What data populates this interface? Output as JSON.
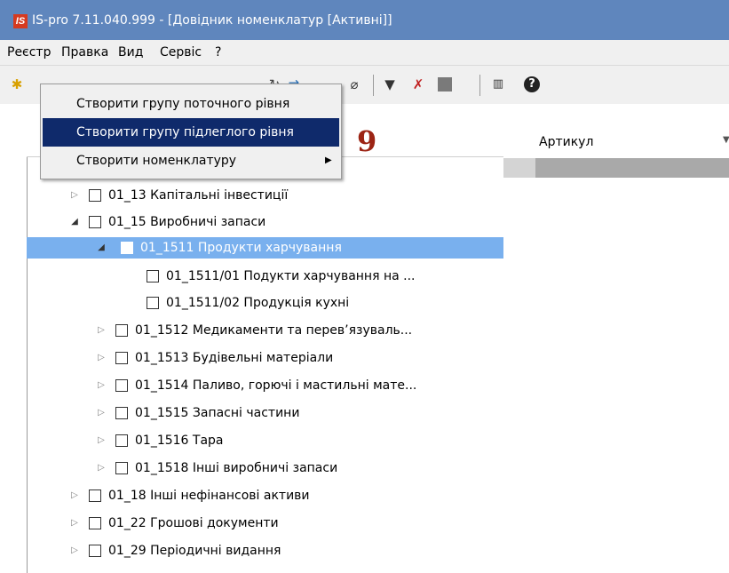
{
  "window": {
    "title": "IS-pro 7.11.040.999 - [Довідник номенклатур [Активні]]",
    "logo_text": "IS"
  },
  "menu": [
    "Реєстр",
    "Правка",
    "Вид",
    "Сервіс",
    "?"
  ],
  "toolbar": {
    "icons": [
      "new-icon",
      "edit-icon",
      "delete-icon",
      "save-icon",
      "print-icon",
      "undo-icon",
      "refresh-icon",
      "transfer-icon",
      "attach-icon",
      "filter-icon",
      "clear-filter-icon",
      "gray-square-icon",
      "columns-icon",
      "help-icon"
    ]
  },
  "context_menu": {
    "items": [
      {
        "label": "Створити групу поточного рівня",
        "highlighted": false
      },
      {
        "label": "Створити групу підлеглого рівня",
        "highlighted": true
      },
      {
        "label": "Створити номенклатуру",
        "submenu": true
      }
    ]
  },
  "annotation": "9",
  "grid": {
    "columns": [
      "Артикул"
    ]
  },
  "tree": [
    {
      "label": "01_13 Капітальні інвестиції",
      "expanded": false
    },
    {
      "label": "01_15 Виробничі запаси",
      "expanded": true
    },
    {
      "label": "01_1511 Продукти харчування",
      "expanded": true,
      "selected": true
    },
    {
      "label": "01_1511/01 Подукти харчування на ..."
    },
    {
      "label": "01_1511/02 Продукція кухні"
    },
    {
      "label": "01_1512 Медикаменти та перев’язуваль...",
      "expanded": false
    },
    {
      "label": "01_1513 Будівельні матеріали",
      "expanded": false
    },
    {
      "label": "01_1514 Паливо, горючі і мастильні мате...",
      "expanded": false
    },
    {
      "label": "01_1515 Запасні частини",
      "expanded": false
    },
    {
      "label": "01_1516 Тара",
      "expanded": false
    },
    {
      "label": "01_1518 Інші виробничі запаси",
      "expanded": false
    },
    {
      "label": "01_18 Інші нефінансові активи",
      "expanded": false
    },
    {
      "label": "01_22 Грошові документи",
      "expanded": false
    },
    {
      "label": "01_29 Періодичні видання",
      "expanded": false
    }
  ]
}
